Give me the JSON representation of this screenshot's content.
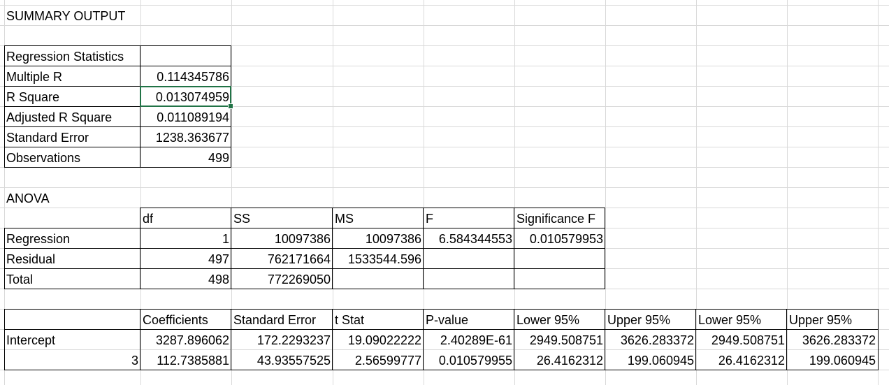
{
  "sheet": {
    "summary_title": "SUMMARY OUTPUT",
    "regression_statistics": {
      "header": "Regression Statistics",
      "rows": [
        {
          "label": "Multiple R",
          "value": "0.114345786"
        },
        {
          "label": "R Square",
          "value": "0.013074959"
        },
        {
          "label": "Adjusted R Square",
          "value": "0.011089194"
        },
        {
          "label": "Standard Error",
          "value": "1238.363677"
        },
        {
          "label": "Observations",
          "value": "499"
        }
      ]
    },
    "anova": {
      "title": "ANOVA",
      "headers": [
        "df",
        "SS",
        "MS",
        "F",
        "Significance F"
      ],
      "rows": [
        {
          "label": "Regression",
          "df": "1",
          "ss": "10097386",
          "ms": "10097386",
          "f": "6.584344553",
          "sig_f": "0.010579953"
        },
        {
          "label": "Residual",
          "df": "497",
          "ss": "762171664",
          "ms": "1533544.596",
          "f": "",
          "sig_f": ""
        },
        {
          "label": "Total",
          "df": "498",
          "ss": "772269050",
          "ms": "",
          "f": "",
          "sig_f": ""
        }
      ]
    },
    "coefficients": {
      "headers": [
        "Coefficients",
        "Standard Error",
        "t Stat",
        "P-value",
        "Lower 95%",
        "Upper 95%",
        "Lower 95%",
        "Upper 95%"
      ],
      "rows": [
        {
          "label": "Intercept",
          "values": [
            "3287.896062",
            "172.2293237",
            "19.09022222",
            "2.40289E-61",
            "2949.508751",
            "3626.283372",
            "2949.508751",
            "3626.283372"
          ]
        },
        {
          "label": "3",
          "values": [
            "112.7385881",
            "43.93557525",
            "2.56599777",
            "0.010579955",
            "26.4162312",
            "199.060945",
            "26.4162312",
            "199.060945"
          ]
        }
      ]
    },
    "selected_cell": "R Square value",
    "selection_color": "#217346"
  }
}
